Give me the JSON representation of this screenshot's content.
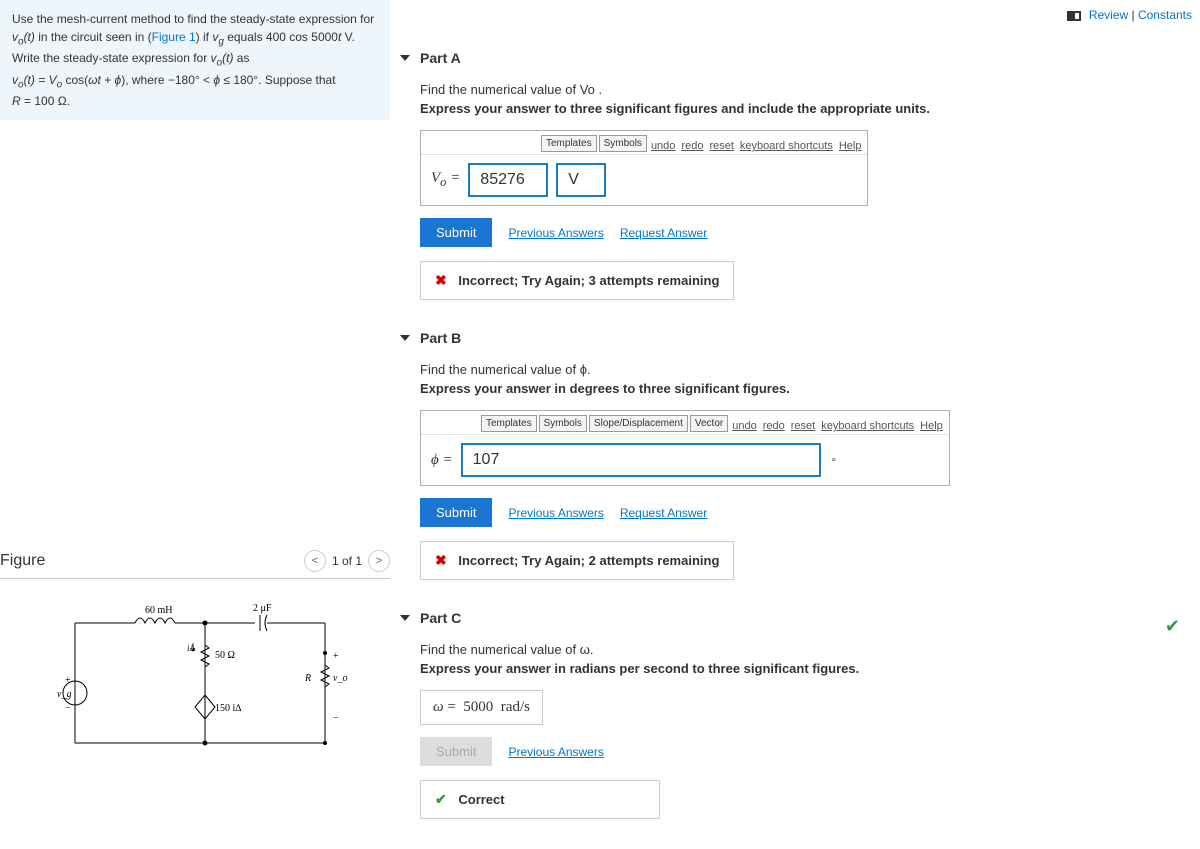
{
  "header": {
    "review_link": "Review",
    "constants_link": "Constants"
  },
  "problem": {
    "line1_a": "Use the mesh-current method to find the steady-state expression for ",
    "line1_b": " in the circuit seen in (",
    "figure_link": "Figure 1",
    "line1_c": ") if ",
    "line1_d": " equals ",
    "line2": "Write the steady-state expression for ",
    "line2_as": " as",
    "line3_a": ", where ",
    "line3_b": ". Suppose that ",
    "line4": "."
  },
  "figure": {
    "title": "Figure",
    "page": "1 of 1",
    "labels": {
      "l60mh": "60 mH",
      "l2uf": "2 μF",
      "r50": "50 Ω",
      "i150": "150",
      "vg": "vg",
      "R": "R",
      "vo": "vo",
      "ia": "iΔ",
      "ia2": "i∆"
    }
  },
  "partA": {
    "title": "Part A",
    "instr1": "Find the numerical value of Vo .",
    "instr2": "Express your answer to three significant figures and include the appropriate units.",
    "toolbar": {
      "templates": "Templates",
      "symbols": "Symbols",
      "undo": "undo",
      "redo": "redo",
      "reset": "reset",
      "shortcuts": "keyboard shortcuts",
      "help": "Help"
    },
    "var": "Vo  = ",
    "value": "85276",
    "unit": "V",
    "submit": "Submit",
    "prev": "Previous Answers",
    "req": "Request Answer",
    "feedback": "Incorrect; Try Again; 3 attempts remaining"
  },
  "partB": {
    "title": "Part B",
    "instr1": "Find the numerical value of ϕ.",
    "instr2": "Express your answer in degrees to three significant figures.",
    "toolbar": {
      "templates": "Templates",
      "symbols": "Symbols",
      "slope": "Slope/Displacement",
      "vector": "Vector",
      "undo": "undo",
      "redo": "redo",
      "reset": "reset",
      "shortcuts": "keyboard shortcuts",
      "help": "Help"
    },
    "var": "ϕ = ",
    "value": "107",
    "submit": "Submit",
    "prev": "Previous Answers",
    "req": "Request Answer",
    "feedback": "Incorrect; Try Again; 2 attempts remaining"
  },
  "partC": {
    "title": "Part C",
    "instr1": "Find the numerical value of ω.",
    "instr2": "Express your answer in radians per second to three significant figures.",
    "answer": "ω =  5000  rad/s",
    "submit": "Submit",
    "prev": "Previous Answers",
    "feedback": "Correct"
  }
}
